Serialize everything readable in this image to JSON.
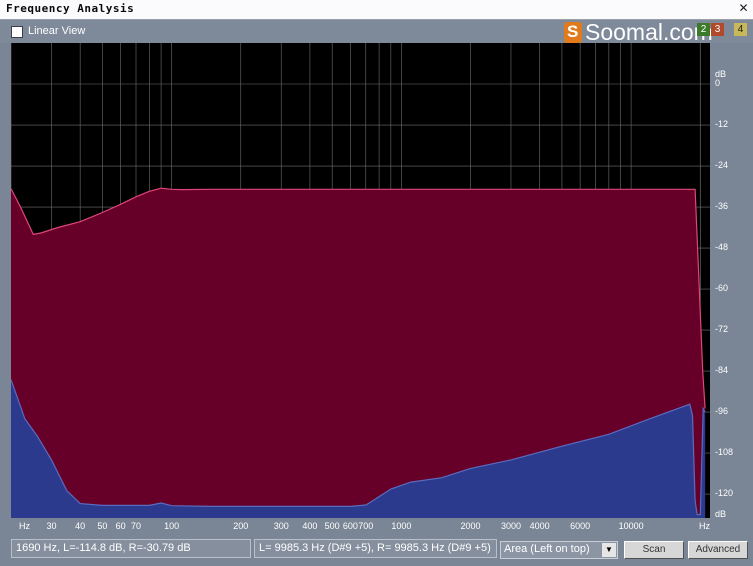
{
  "window": {
    "title": "Frequency Analysis",
    "close_icon": "close-icon"
  },
  "toolbar": {
    "linear_view_label": "Linear View",
    "linear_view_checked": false
  },
  "logo": {
    "text": "Soomal.com",
    "badge_2": "2",
    "badge_3": "3",
    "badge_4": "4"
  },
  "chart_data": {
    "type": "area",
    "x_scale": "log",
    "y_unit": "dB",
    "x_unit": "Hz",
    "x_tick_labels": [
      "30",
      "40",
      "50",
      "60",
      "70",
      "100",
      "200",
      "300",
      "400",
      "500",
      "600",
      "700",
      "1000",
      "2000",
      "3000",
      "4000",
      "6000",
      "10000"
    ],
    "y_tick_labels": [
      "0",
      "-12",
      "-24",
      "-36",
      "-48",
      "-60",
      "-72",
      "-84",
      "-96",
      "-108",
      "-120"
    ],
    "ylim": [
      -127,
      12
    ],
    "xlim": [
      20,
      22050
    ],
    "series": [
      {
        "color": "#660028",
        "outline": "#e0457a",
        "points": [
          [
            20,
            -30.6
          ],
          [
            22,
            -36
          ],
          [
            25,
            -44
          ],
          [
            27,
            -43.6
          ],
          [
            32,
            -42
          ],
          [
            40,
            -40.3
          ],
          [
            50,
            -37.6
          ],
          [
            60,
            -35.2
          ],
          [
            70,
            -33
          ],
          [
            80,
            -31.4
          ],
          [
            90,
            -30.5
          ],
          [
            100,
            -30.8
          ],
          [
            110,
            -30.9
          ],
          [
            150,
            -30.8
          ],
          [
            1000,
            -30.8
          ],
          [
            10000,
            -30.8
          ],
          [
            19000,
            -30.8
          ],
          [
            19800,
            -60
          ],
          [
            20500,
            -84
          ],
          [
            21000,
            -95
          ]
        ]
      },
      {
        "color": "#2b3a8c",
        "outline": "#5b6bc0",
        "points": [
          [
            20,
            -86.5
          ],
          [
            23,
            -98
          ],
          [
            26,
            -103
          ],
          [
            30,
            -110
          ],
          [
            35,
            -119
          ],
          [
            40,
            -122.8
          ],
          [
            50,
            -123.3
          ],
          [
            80,
            -123.3
          ],
          [
            90,
            -122.6
          ],
          [
            100,
            -123.4
          ],
          [
            150,
            -123.6
          ],
          [
            300,
            -123.6
          ],
          [
            600,
            -123.6
          ],
          [
            700,
            -123.2
          ],
          [
            750,
            -122
          ],
          [
            900,
            -118.5
          ],
          [
            1100,
            -116.5
          ],
          [
            1500,
            -115.2
          ],
          [
            2000,
            -112.5
          ],
          [
            3000,
            -110
          ],
          [
            5000,
            -106
          ],
          [
            8000,
            -102.5
          ],
          [
            12000,
            -98
          ],
          [
            18000,
            -93.7
          ],
          [
            18500,
            -97
          ],
          [
            19000,
            -122
          ],
          [
            19400,
            -126
          ],
          [
            20000,
            -126
          ],
          [
            20600,
            -95
          ],
          [
            21000,
            -96
          ]
        ]
      }
    ]
  },
  "status": {
    "cursor_readout": "1690 Hz, L=-114.8 dB, R=-30.79 dB",
    "peak_readout": "L= 9985.3 Hz (D#9 +5), R= 9985.3 Hz (D#9 +5)",
    "mode_selected": "Area (Left on top)",
    "scan_label": "Scan",
    "advanced_label": "Advanced"
  },
  "colors": {
    "plot_background": "#000000",
    "grid": "#ffffff",
    "left_channel": "#660028",
    "right_channel": "#2b3a8c"
  }
}
